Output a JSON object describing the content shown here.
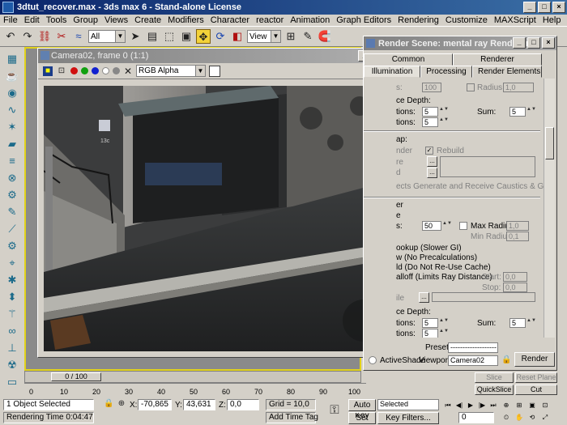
{
  "window": {
    "title": "3dtut_recover.max - 3ds max 6 - Stand-alone License"
  },
  "menu": [
    "File",
    "Edit",
    "Tools",
    "Group",
    "Views",
    "Create",
    "Modifiers",
    "Character",
    "reactor",
    "Animation",
    "Graph Editors",
    "Rendering",
    "Customize",
    "MAXScript",
    "Help"
  ],
  "toolbar": {
    "selection_filter": "All",
    "ref_coord": "View"
  },
  "vfb": {
    "title": "Camera02, frame 0 (1:1)",
    "channel": "RGB Alpha",
    "image": {
      "sign_text": "13c"
    }
  },
  "render_scene": {
    "title": "Render Scene: mental ray Renderer",
    "tabs_row1": [
      "Common",
      "Renderer"
    ],
    "tabs_row2": [
      "Illumination",
      "Processing",
      "Render Elements"
    ],
    "fields": {
      "samples_val": "100",
      "radius_label": "Radius:",
      "radius_val": "1,0",
      "trace_depth_1": "ce Depth:",
      "tions_label": "tions:",
      "reflect_1": "5",
      "sum_label": "Sum:",
      "sum_1": "5",
      "tions_label_2": "tions:",
      "refract_1": "5",
      "map_label": "ap:",
      "nder_label": "nder",
      "rebuild_label": "Rebuild",
      "re_label": "re",
      "d_label": "d",
      "ellipsis": "...",
      "caustics_note": "ects Generate and Receive Caustics & GI",
      "er_label": "er",
      "e_label": "e",
      "s_label": "s:",
      "gi_samples": "50",
      "max_radius_label": "Max Radius:",
      "max_radius_val": "1,0",
      "min_radius_label": "Min Radius:",
      "min_radius_val": "0,1",
      "lookup": "ookup (Slower GI)",
      "no_precalc": "w (No Precalculations)",
      "no_reuse": "ld (Do Not Re-Use Cache)",
      "falloff": "alloff (Limits Ray Distance)",
      "start_label": "Start:",
      "start_val": "0,0",
      "stop_label": "Stop:",
      "stop_val": "0,0",
      "ile_label": "ile",
      "trace_depth_2": "ce Depth:",
      "tions_label_3": "tions:",
      "reflect_2": "5",
      "sum_label_2": "Sum:",
      "sum_2": "5",
      "tions_label_4": "tions:",
      "refract_2": "5"
    },
    "preset_label": "Preset:",
    "preset_val": "------------------------",
    "activeshade_label": "ActiveShade",
    "viewport_label": "Viewport:",
    "viewport_val": "Camera02",
    "render_button": "Render"
  },
  "right_panel": {
    "slice": "Slice",
    "reset_plane": "Reset Plane",
    "quickslice": "QuickSlice",
    "cut": "Cut"
  },
  "timeline": {
    "slider_label": "0 / 100",
    "ticks": [
      "0",
      "10",
      "20",
      "30",
      "40",
      "50",
      "60",
      "70",
      "80",
      "90",
      "100"
    ]
  },
  "status": {
    "selected": "1 Object Selected",
    "render_time": "Rendering Time  0:04:47",
    "x_label": "X:",
    "x_val": "-70,865",
    "y_label": "Y:",
    "y_val": "43,631",
    "z_label": "Z:",
    "z_val": "0,0",
    "grid": "Grid = 10,0",
    "add_time_tag": "Add Time Tag",
    "auto_key": "Auto Key",
    "set_key": "Set Key",
    "selected_dd": "Selected",
    "key_filters": "Key Filters...",
    "frame": "0"
  }
}
